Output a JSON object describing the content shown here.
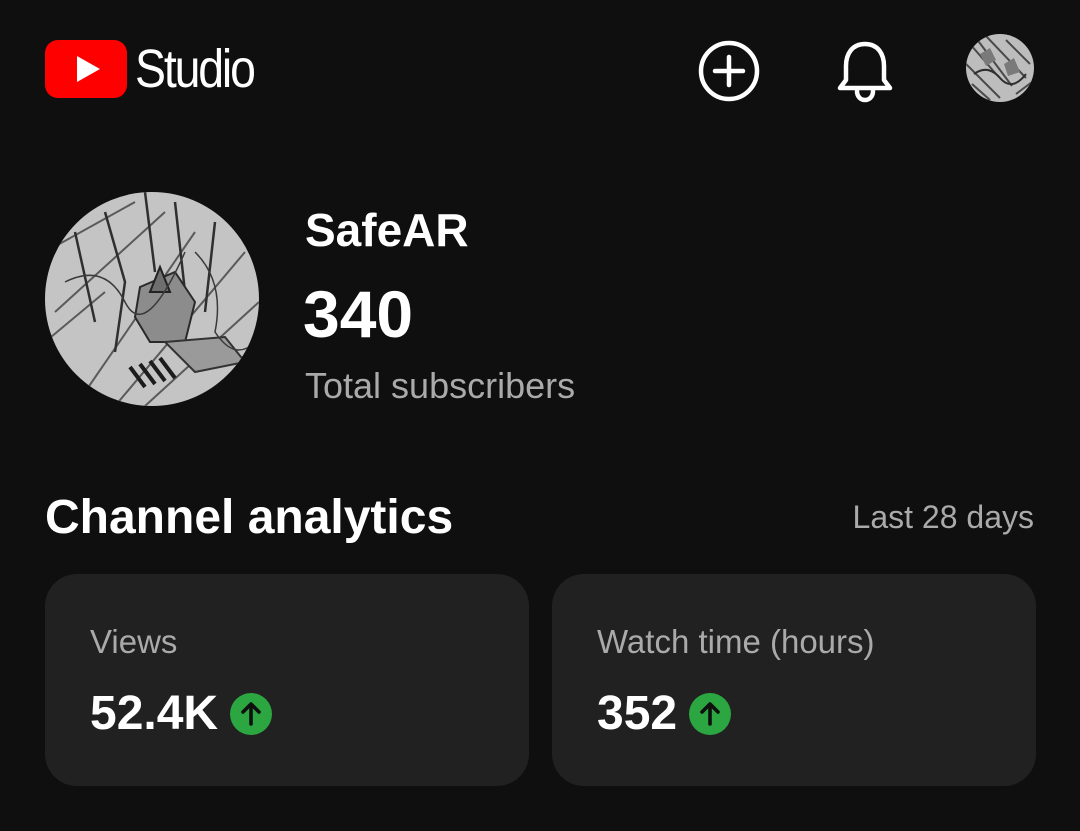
{
  "header": {
    "logo_text": "Studio",
    "create_icon": "add-circle-icon",
    "notifications_icon": "bell-icon",
    "brand_color": "#ff0000"
  },
  "channel": {
    "name": "SafeAR",
    "subscriber_count": "340",
    "subscriber_label": "Total subscribers"
  },
  "analytics": {
    "title": "Channel analytics",
    "period": "Last 28 days",
    "cards": [
      {
        "label": "Views",
        "value": "52.4K",
        "trend": "up",
        "trend_icon": "arrow-up-icon"
      },
      {
        "label": "Watch time (hours)",
        "value": "352",
        "trend": "up",
        "trend_icon": "arrow-up-icon"
      }
    ],
    "trend_up_color": "#2ba640"
  },
  "theme": {
    "background": "#0f0f0f",
    "card_background": "#212121",
    "secondary_text": "#aaaaaa"
  }
}
